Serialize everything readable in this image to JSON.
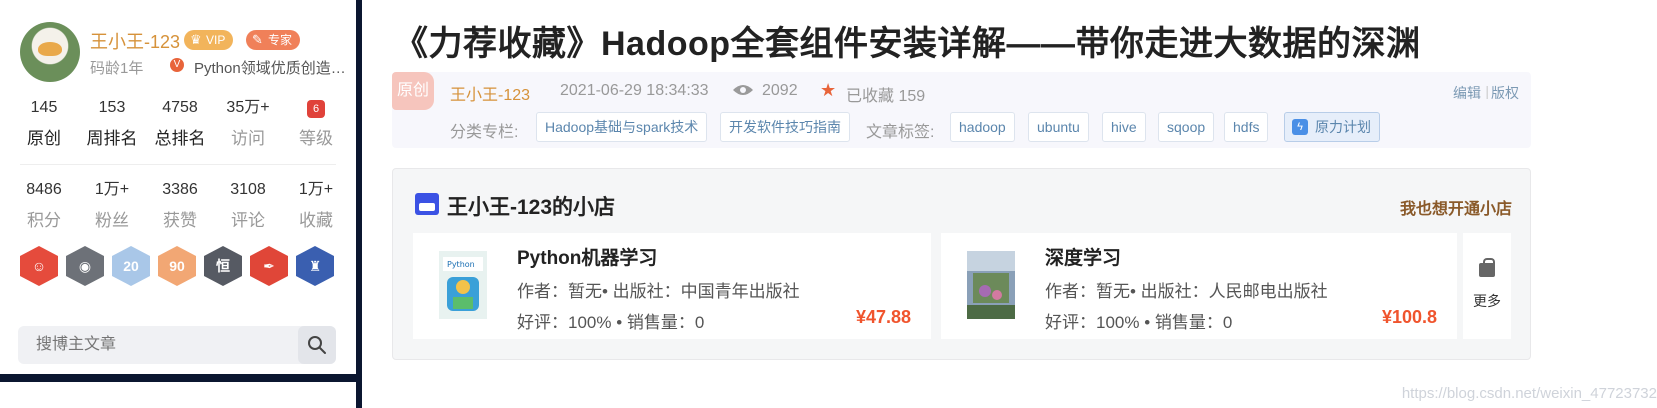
{
  "profile": {
    "username": "王小王-123",
    "vip_label": "VIP",
    "expert_label": "专家",
    "code_age": "码龄1年",
    "verified_mark": "V",
    "subtitle": "Python领域优质创造…",
    "stats_row1": [
      {
        "value": "145",
        "label": "原创"
      },
      {
        "value": "153",
        "label": "周排名"
      },
      {
        "value": "4758",
        "label": "总排名"
      },
      {
        "value": "35万+",
        "label": "访问"
      },
      {
        "value": "6",
        "label": "等级"
      }
    ],
    "stats_row2": [
      {
        "value": "8486",
        "label": "积分"
      },
      {
        "value": "1万+",
        "label": "粉丝"
      },
      {
        "value": "3386",
        "label": "获赞"
      },
      {
        "value": "3108",
        "label": "评论"
      },
      {
        "value": "1万+",
        "label": "收藏"
      }
    ],
    "badges": [
      {
        "icon": "monkey-badge-icon",
        "color": "#e54b3c",
        "glyph": "☺"
      },
      {
        "icon": "github-badge-icon",
        "color": "#6d7178",
        "glyph": "◉"
      },
      {
        "icon": "anniversary-badge-icon",
        "color": "#a9c7e8",
        "glyph": "20"
      },
      {
        "icon": "expert-90-badge-icon",
        "color": "#f2a774",
        "glyph": "90"
      },
      {
        "icon": "column-badge-icon",
        "color": "#565a63",
        "glyph": "恒"
      },
      {
        "icon": "pen-badge-icon",
        "color": "#e04638",
        "glyph": "✒"
      },
      {
        "icon": "rocket-badge-icon",
        "color": "#3a5fb0",
        "glyph": "♜"
      }
    ]
  },
  "search": {
    "placeholder": "搜博主文章"
  },
  "article": {
    "title": "《力荐收藏》Hadoop全套组件安装详解——带你走进大数据的深渊",
    "original_tag": "原创",
    "author": "王小王-123",
    "datetime": "2021-06-29 18:34:33",
    "views": "2092",
    "favorites": "已收藏 159",
    "edit_label": "编辑",
    "copyright_label": "版权",
    "category_label": "分类专栏:",
    "categories": [
      "Hadoop基础与spark技术",
      "开发软件技巧指南"
    ],
    "tags_label": "文章标签:",
    "tags": [
      "hadoop",
      "ubuntu",
      "hive",
      "sqoop",
      "hdfs"
    ],
    "special_tag": "原力计划"
  },
  "shop": {
    "title": "王小王-123的小店",
    "open_label": "我也想开通小店",
    "products": [
      {
        "name": "Python机器学习",
        "info": "作者：暂无• 出版社：中国青年出版社",
        "rating": "好评：100% • 销售量：0",
        "price": "¥47.88"
      },
      {
        "name": "深度学习",
        "info": "作者：暂无• 出版社：人民邮电出版社",
        "rating": "好评：100% • 销售量：0",
        "price": "¥100.8"
      }
    ],
    "more_label": "更多"
  },
  "watermark": "https://blog.csdn.net/weixin_47723732"
}
